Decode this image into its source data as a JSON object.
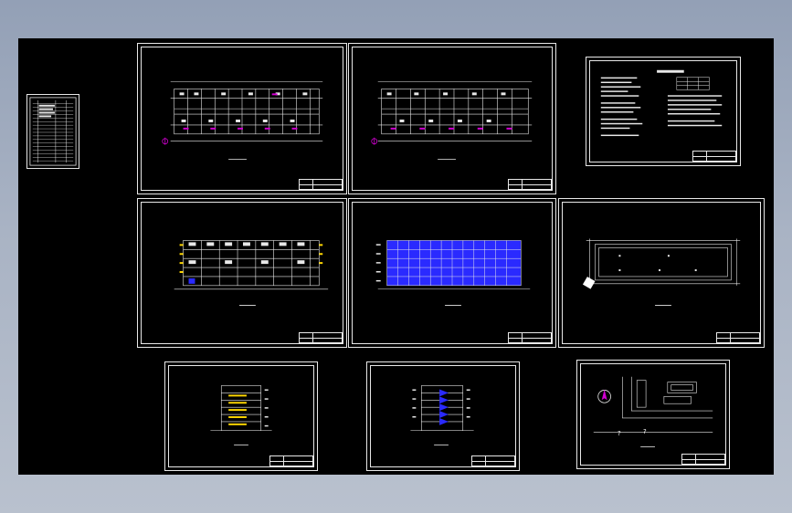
{
  "app": {
    "window_title": "",
    "background_color": "#93a0b6",
    "canvas_color": "#000000",
    "line_color": "#e8e8e8",
    "accent_colors": {
      "grid_blue": "#2a2aff",
      "axis_yellow": "#ffd700",
      "section_magenta": "#d000d0",
      "symbol_white": "#ffffff"
    }
  },
  "sheets": [
    {
      "id": "index",
      "kind": "drawing-index"
    },
    {
      "id": "plan-1",
      "kind": "floor-plan"
    },
    {
      "id": "plan-2",
      "kind": "floor-plan"
    },
    {
      "id": "notes",
      "kind": "design-notes"
    },
    {
      "id": "elev-1",
      "kind": "elevation"
    },
    {
      "id": "elev-2",
      "kind": "elevation-blue"
    },
    {
      "id": "roof",
      "kind": "roof-plan"
    },
    {
      "id": "side-1",
      "kind": "side-elevation"
    },
    {
      "id": "side-2",
      "kind": "section"
    },
    {
      "id": "site",
      "kind": "site-plan"
    }
  ],
  "site": {
    "marker_a": "?",
    "marker_b": "?"
  }
}
